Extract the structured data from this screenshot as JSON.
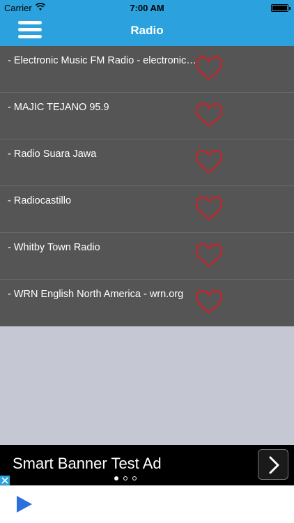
{
  "status_bar": {
    "carrier": "Carrier",
    "time": "7:00 AM",
    "wifi_icon": "wifi-icon",
    "battery_icon": "battery-icon"
  },
  "nav": {
    "title": "Radio",
    "menu_icon": "hamburger-menu-icon"
  },
  "stations": [
    {
      "label": "- Electronic Music FM Radio - electronic…",
      "favorite_icon": "heart-outline-icon"
    },
    {
      "label": "- MAJIC TEJANO 95.9",
      "favorite_icon": "heart-outline-icon"
    },
    {
      "label": "- Radio Suara Jawa",
      "favorite_icon": "heart-outline-icon"
    },
    {
      "label": "- Radiocastillo",
      "favorite_icon": "heart-outline-icon"
    },
    {
      "label": "- Whitby Town Radio",
      "favorite_icon": "heart-outline-icon"
    },
    {
      "label": "- WRN English North America - wrn.org",
      "favorite_icon": "heart-outline-icon"
    }
  ],
  "ad": {
    "text": "Smart Banner Test Ad",
    "arrow_icon": "chevron-right-icon",
    "pages": 3,
    "active_page": 1
  },
  "player": {
    "play_icon": "play-icon"
  },
  "colors": {
    "accent": "#2ba2dd",
    "list_bg": "#555555",
    "heart": "#c0272d",
    "page_bg": "#c5c7d3",
    "play": "#2a6fdc"
  }
}
